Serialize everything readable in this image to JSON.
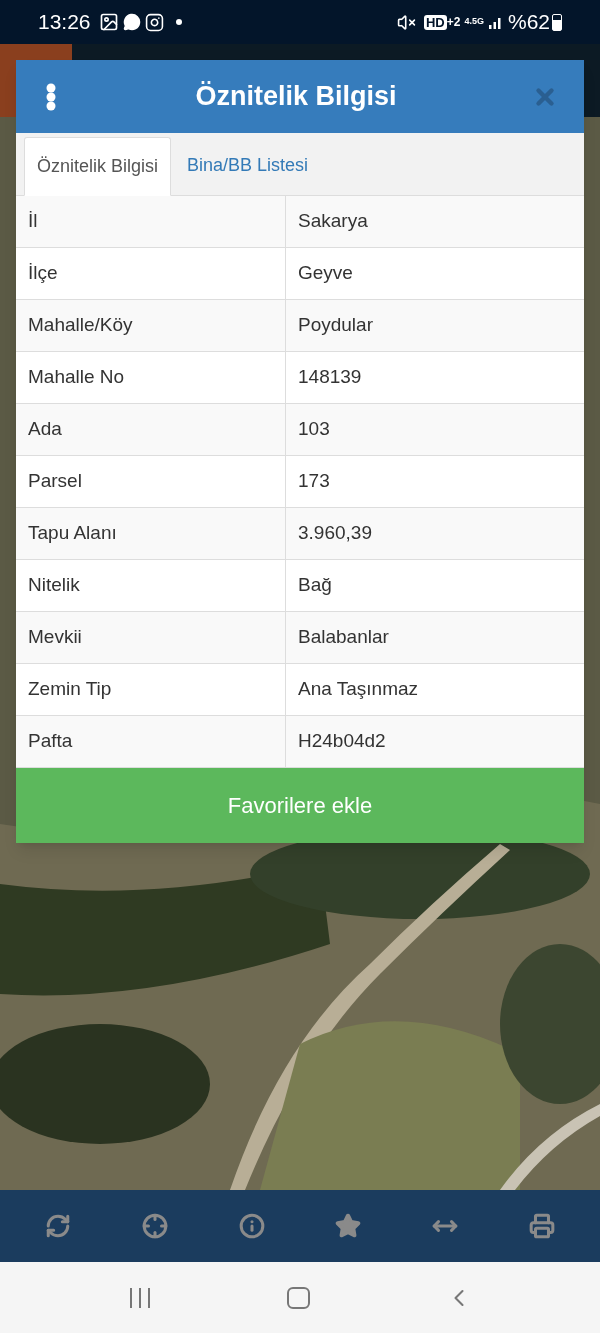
{
  "status_bar": {
    "time": "13:26",
    "hd": "HD",
    "hd_sub": "+2",
    "network": "4.5G",
    "battery": "%62"
  },
  "dialog": {
    "title": "Öznitelik Bilgisi",
    "tabs": [
      {
        "label": "Öznitelik Bilgisi",
        "selected": true
      },
      {
        "label": "Bina/BB Listesi",
        "selected": false
      }
    ],
    "rows": [
      {
        "label": "İl",
        "value": "Sakarya"
      },
      {
        "label": "İlçe",
        "value": "Geyve"
      },
      {
        "label": "Mahalle/Köy",
        "value": "Poydular"
      },
      {
        "label": "Mahalle No",
        "value": "148139"
      },
      {
        "label": "Ada",
        "value": "103"
      },
      {
        "label": "Parsel",
        "value": "173"
      },
      {
        "label": "Tapu Alanı",
        "value": "3.960,39"
      },
      {
        "label": "Nitelik",
        "value": "Bağ"
      },
      {
        "label": "Mevkii",
        "value": "Balabanlar"
      },
      {
        "label": "Zemin Tip",
        "value": "Ana Taşınmaz"
      },
      {
        "label": "Pafta",
        "value": "H24b04d2"
      }
    ],
    "button": "Favorilere ekle"
  },
  "toolbar": [
    {
      "kind": "refresh"
    },
    {
      "kind": "locate"
    },
    {
      "kind": "info"
    },
    {
      "kind": "star"
    },
    {
      "kind": "measure"
    },
    {
      "kind": "print"
    }
  ]
}
